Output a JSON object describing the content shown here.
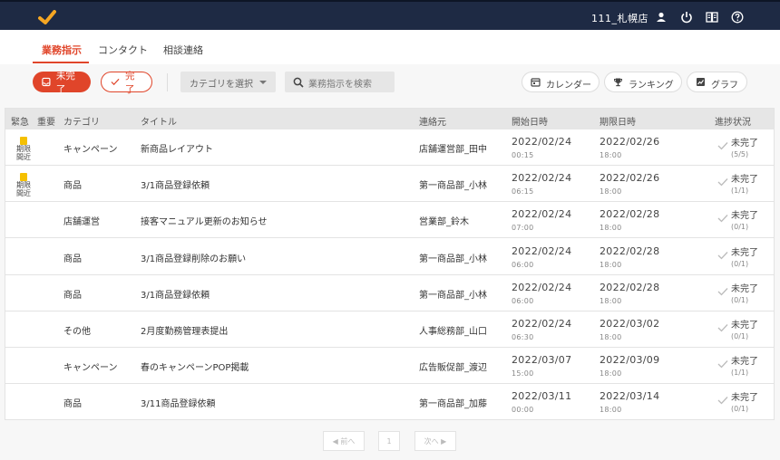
{
  "header": {
    "store_name": "111_札幌店",
    "icons": [
      "logo-check-icon",
      "user-icon",
      "power-icon",
      "book-icon",
      "help-icon"
    ]
  },
  "tabs": [
    {
      "label": "業務指示",
      "active": true
    },
    {
      "label": "コンタクト",
      "active": false
    },
    {
      "label": "相談連絡",
      "active": false
    }
  ],
  "toolbar": {
    "incomplete_label": "未完了",
    "complete_label": "完了",
    "category_select": "カテゴリを選択",
    "search_placeholder": "業務指示を検索",
    "calendar_label": "カレンダー",
    "ranking_label": "ランキング",
    "graph_label": "グラフ"
  },
  "table": {
    "headers": {
      "urgent": "緊急",
      "important": "重要",
      "category": "カテゴリ",
      "title": "タイトル",
      "contact": "連絡元",
      "start": "開始日時",
      "deadline": "期限日時",
      "progress": "進捗状況"
    },
    "rows": [
      {
        "badge": "期限間近",
        "category": "キャンペーン",
        "title": "新商品レイアウト",
        "contact": "店舗運営部_田中",
        "start_date": "2022/02/24",
        "start_time": "00:15",
        "end_date": "2022/02/26",
        "end_time": "18:00",
        "status": "未完了",
        "count": "(5/5)"
      },
      {
        "badge": "期限間近",
        "category": "商品",
        "title": "3/1商品登録依頼",
        "contact": "第一商品部_小林",
        "start_date": "2022/02/24",
        "start_time": "06:15",
        "end_date": "2022/02/26",
        "end_time": "18:00",
        "status": "未完了",
        "count": "(1/1)"
      },
      {
        "badge": "",
        "category": "店舗運営",
        "title": "接客マニュアル更新のお知らせ",
        "contact": "営業部_鈴木",
        "start_date": "2022/02/24",
        "start_time": "07:00",
        "end_date": "2022/02/28",
        "end_time": "18:00",
        "status": "未完了",
        "count": "(0/1)"
      },
      {
        "badge": "",
        "category": "商品",
        "title": "3/1商品登録削除のお願い",
        "contact": "第一商品部_小林",
        "start_date": "2022/02/24",
        "start_time": "06:00",
        "end_date": "2022/02/28",
        "end_time": "18:00",
        "status": "未完了",
        "count": "(0/1)"
      },
      {
        "badge": "",
        "category": "商品",
        "title": "3/1商品登録依頼",
        "contact": "第一商品部_小林",
        "start_date": "2022/02/24",
        "start_time": "06:00",
        "end_date": "2022/02/28",
        "end_time": "18:00",
        "status": "未完了",
        "count": "(0/1)"
      },
      {
        "badge": "",
        "category": "その他",
        "title": "2月度勤務管理表提出",
        "contact": "人事総務部_山口",
        "start_date": "2022/02/24",
        "start_time": "06:30",
        "end_date": "2022/03/02",
        "end_time": "18:00",
        "status": "未完了",
        "count": "(0/1)"
      },
      {
        "badge": "",
        "category": "キャンペーン",
        "title": "春のキャンペーンPOP掲載",
        "contact": "広告販促部_渡辺",
        "start_date": "2022/03/07",
        "start_time": "15:00",
        "end_date": "2022/03/09",
        "end_time": "18:00",
        "status": "未完了",
        "count": "(1/1)"
      },
      {
        "badge": "",
        "category": "商品",
        "title": "3/11商品登録依頼",
        "contact": "第一商品部_加藤",
        "start_date": "2022/03/11",
        "start_time": "00:00",
        "end_date": "2022/03/14",
        "end_time": "18:00",
        "status": "未完了",
        "count": "(0/1)"
      }
    ]
  },
  "pager": {
    "prev_label": "◀ 前へ",
    "page": "1",
    "next_label": "次へ ▶"
  },
  "colors": {
    "accent": "#e0452a",
    "navbar": "#1e2a44",
    "badge": "#f5c000",
    "logo": "#f5a623"
  }
}
